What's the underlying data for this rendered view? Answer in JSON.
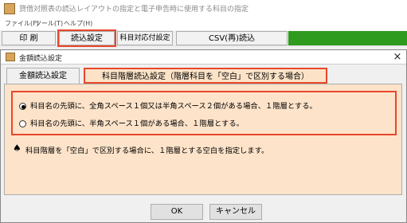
{
  "app": {
    "title": "貸借対照表の読込レイアウトの指定と電子申告時に使用する科目の指定",
    "menu": [
      "ファイル(F)",
      "ツール(T)",
      "ヘルプ(H)"
    ],
    "toolbar": {
      "print_label": "印 刷",
      "read_settings_label": "読込設定",
      "account_mapping_label": "科目対応付設定",
      "csv_reread_label": "CSV(再)読込"
    }
  },
  "dialog": {
    "title": "金額読込設定",
    "close_symbol": "×",
    "tabs": [
      {
        "label": "金額読込設定"
      },
      {
        "label": "科目階層読込設定（階層科目を「空白」で区別する場合）"
      }
    ],
    "options": [
      {
        "label": "科目名の先頭に、全角スペース１個又は半角スペース２個がある場合、１階層とする。",
        "selected": true
      },
      {
        "label": "科目名の先頭に、半角スペース１個がある場合、１階層とする。",
        "selected": false
      }
    ],
    "note": {
      "icon": "spade-icon",
      "symbol": "♠",
      "text": "科目階層を「空白」で区別する場合に、１階層とする空白を指定します。"
    },
    "ok_label": "OK",
    "cancel_label": "キャンセル"
  },
  "colors": {
    "highlight": "#e8472b",
    "panel_bg": "#fde3c9",
    "toolbar_green": "#2e9a1e"
  }
}
